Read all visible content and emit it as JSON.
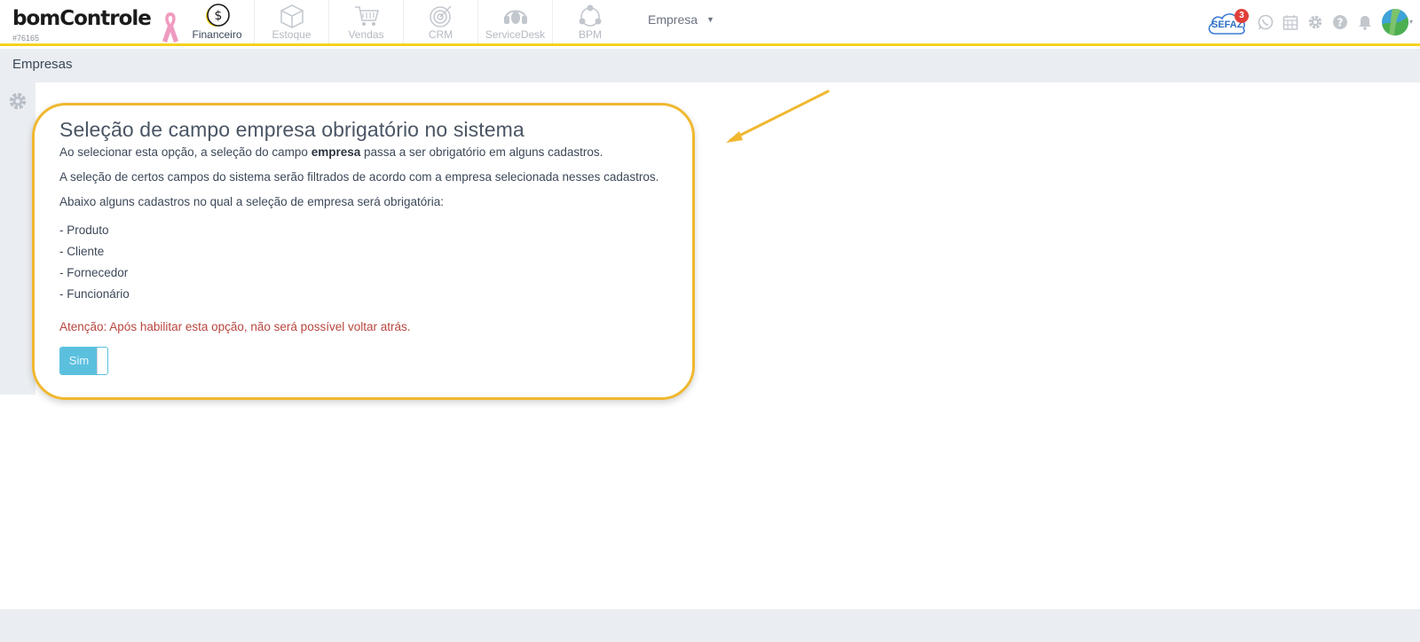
{
  "brand": {
    "logo_text": "bomControle",
    "account_code": "#76165"
  },
  "nav": {
    "items": [
      {
        "label": "Financeiro",
        "icon": "dollar-coin-icon",
        "active": true
      },
      {
        "label": "Estoque",
        "icon": "box-icon",
        "active": false
      },
      {
        "label": "Vendas",
        "icon": "shopping-cart-icon",
        "active": false
      },
      {
        "label": "CRM",
        "icon": "target-icon",
        "active": false
      },
      {
        "label": "ServiceDesk",
        "icon": "headset-icon",
        "active": false
      },
      {
        "label": "BPM",
        "icon": "process-cycle-icon",
        "active": false
      }
    ],
    "empresa_select": "Empresa"
  },
  "header_right": {
    "sefaz_label": "SEFAZ",
    "sefaz_badge": "3",
    "icons": [
      "whatsapp-icon",
      "calendar-icon",
      "gear-icon",
      "help-icon",
      "bell-icon",
      "avatar"
    ]
  },
  "page": {
    "title": "Empresas"
  },
  "card": {
    "title": "Seleção de campo empresa obrigatório no sistema",
    "p1_before": "Ao selecionar esta opção, a seleção do campo ",
    "p1_bold": "empresa",
    "p1_after": " passa a ser obrigatório em alguns cadastros.",
    "p2": "A seleção de certos campos do sistema serão filtrados de acordo com a empresa selecionada nesses cadastros.",
    "p3": "Abaixo alguns cadastros no qual a seleção de empresa será obrigatória:",
    "list": [
      "- Produto",
      "- Cliente",
      "- Fornecedor",
      "- Funcionário"
    ],
    "warning": "Atenção: Após habilitar esta opção, não será possível voltar atrás.",
    "toggle_label": "Sim"
  },
  "colors": {
    "highlight_border": "#f0b830",
    "topbar_underline": "#f5d21f",
    "toggle_on": "#5bc0de",
    "warning_text": "#b8463f",
    "panel_bg": "#eaedf1"
  }
}
